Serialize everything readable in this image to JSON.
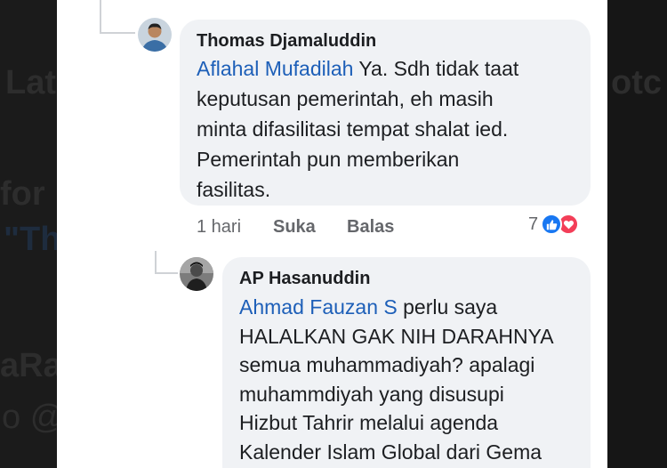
{
  "comments": [
    {
      "author": "Thomas Djamaluddin",
      "mention": "Aflahal Mufadilah",
      "lines": [
        " Ya. Sdh tidak taat",
        "keputusan pemerintah, eh masih",
        "minta difasilitasi tempat shalat ied.",
        "Pemerintah pun memberikan",
        "fasilitas."
      ],
      "time": "1 hari",
      "like_label": "Suka",
      "reply_label": "Balas",
      "reaction_count": "7",
      "reactions": [
        "like-icon",
        "love-icon"
      ]
    },
    {
      "author": "AP Hasanuddin",
      "mention": "Ahmad Fauzan S",
      "lines": [
        " perlu saya",
        "HALALKAN GAK NIH DARAHNYA",
        "semua muhammadiyah? apalagi",
        "muhammdiyah yang disusupi",
        "Hizbut Tahrir melalui agenda",
        "Kalender Islam Global dari Gema"
      ]
    }
  ],
  "background_fragments": [
    "Lat",
    "for",
    "\"Th",
    "aRa",
    "o @",
    "otc"
  ],
  "colors": {
    "mention": "#1d5fb8",
    "bubble": "#f0f2f5",
    "like": "#1877f2",
    "love": "#f33e58"
  }
}
